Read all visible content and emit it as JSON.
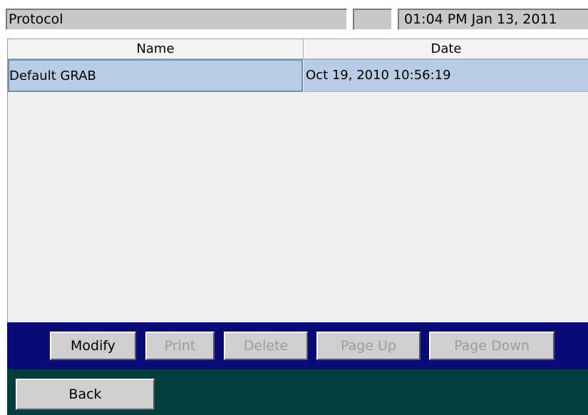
{
  "header": {
    "app_title": "Protocol",
    "status_blank": "",
    "clock": "01:04 PM Jan 13, 2011"
  },
  "table": {
    "columns": [
      "Name",
      "Date"
    ],
    "rows": [
      {
        "name": "Default GRAB",
        "date": "Oct 19, 2010 10:56:19",
        "selected": true
      }
    ]
  },
  "actions": {
    "modify": "Modify",
    "print": "Print",
    "delete": "Delete",
    "page_up": "Page Up",
    "page_down": "Page Down"
  },
  "navigation": {
    "back": "Back"
  },
  "colors": {
    "action_bar": "#0a0a78",
    "bottom_bar": "#003e3e",
    "selected_row": "#b8cce4"
  }
}
